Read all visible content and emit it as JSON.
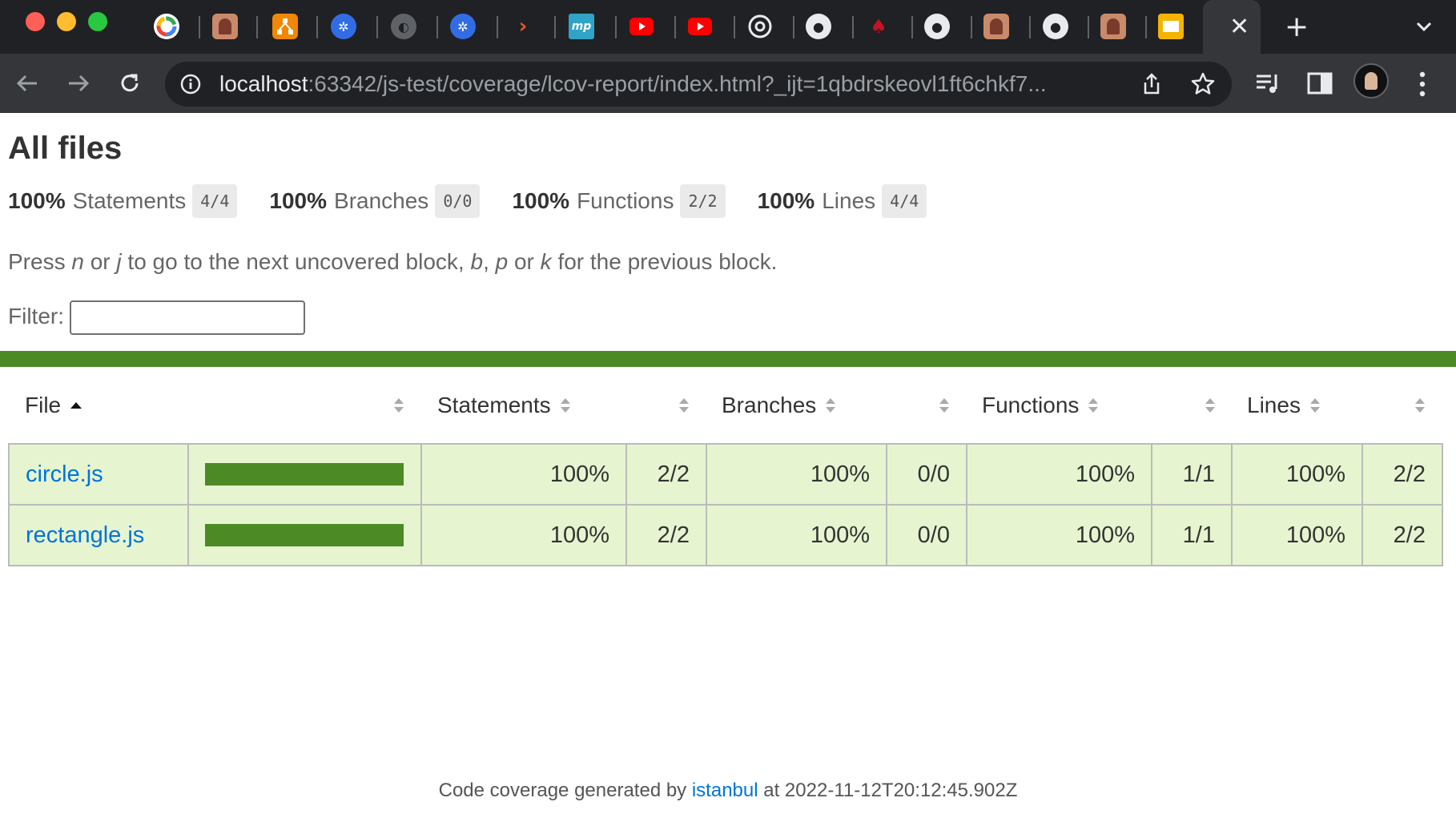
{
  "browser": {
    "url_host": "localhost",
    "url_rest": ":63342/js-test/coverage/lcov-report/index.html?_ijt=1qbdrskeovl1ft6chkf7...",
    "tab_favicons": [
      "google-icon",
      "profile-photo-icon",
      "draw-io-icon",
      "kubernetes-icon",
      "globe-icon",
      "kubernetes-icon",
      "terminal-icon",
      "mp-icon",
      "youtube-icon",
      "youtube-icon",
      "chrome-icon",
      "github-icon",
      "jest-icon",
      "github-icon",
      "profile-photo-icon",
      "github-icon",
      "profile-photo-icon",
      "slides-icon"
    ],
    "mp_favicon_text": "mp",
    "active_tab_close": "✕",
    "new_tab": "+"
  },
  "report": {
    "title": "All files",
    "summary": [
      {
        "pct": "100%",
        "label": "Statements",
        "fraction": "4/4"
      },
      {
        "pct": "100%",
        "label": "Branches",
        "fraction": "0/0"
      },
      {
        "pct": "100%",
        "label": "Functions",
        "fraction": "2/2"
      },
      {
        "pct": "100%",
        "label": "Lines",
        "fraction": "4/4"
      }
    ],
    "hint": {
      "t1": "Press ",
      "k_n": "n",
      "t2": " or ",
      "k_j": "j",
      "t3": " to go to the next uncovered block, ",
      "k_b": "b",
      "t4": ", ",
      "k_p": "p",
      "t5": " or ",
      "k_k": "k",
      "t6": " for the previous block."
    },
    "filter_label": "Filter:",
    "filter_value": "",
    "columns": {
      "file": "File",
      "statements": "Statements",
      "branches": "Branches",
      "functions": "Functions",
      "lines": "Lines"
    },
    "rows": [
      {
        "file": "circle.js",
        "coverage_fraction": 1.0,
        "statements_pct": "100%",
        "statements": "2/2",
        "branches_pct": "100%",
        "branches": "0/0",
        "functions_pct": "100%",
        "functions": "1/1",
        "lines_pct": "100%",
        "lines": "2/2"
      },
      {
        "file": "rectangle.js",
        "coverage_fraction": 1.0,
        "statements_pct": "100%",
        "statements": "2/2",
        "branches_pct": "100%",
        "branches": "0/0",
        "functions_pct": "100%",
        "functions": "1/1",
        "lines_pct": "100%",
        "lines": "2/2"
      }
    ],
    "footer": {
      "prefix": "Code coverage generated by ",
      "link": "istanbul",
      "suffix": " at 2022-11-12T20:12:45.902Z"
    }
  },
  "colors": {
    "high_coverage": "#4b8a25",
    "row_background": "#e6f5d0",
    "link": "#0074d9"
  }
}
